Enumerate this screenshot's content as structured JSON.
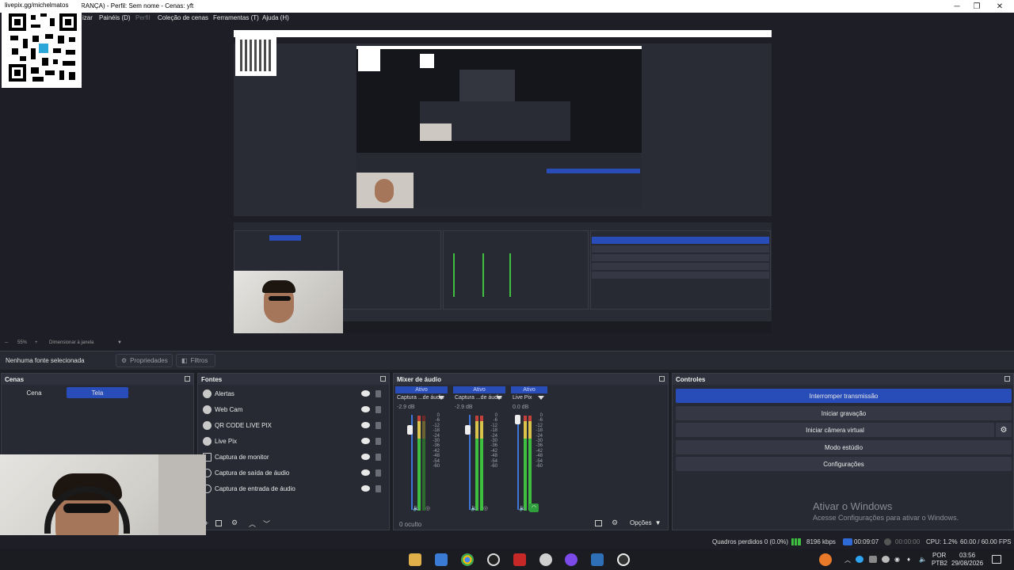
{
  "window": {
    "title": "GURANÇA) - Perfil: Sem nome - Cenas: yft",
    "minimize": "─",
    "maximize": "❐",
    "close": "✕"
  },
  "menu": {
    "items": [
      "izar",
      "Painéis (D)",
      "Perfil",
      "Coleção de cenas",
      "Ferramentas (T)",
      "Ajuda (H)"
    ]
  },
  "overlay": {
    "qr_label": "livepix.gg/michelmatos"
  },
  "zoom": {
    "value": "55%",
    "mode": "Dimensionar à janela"
  },
  "context": {
    "no_source": "Nenhuma fonte selecionada",
    "properties": "Propriedades",
    "filters": "Filtros"
  },
  "scenes": {
    "title": "Cenas",
    "items": [
      "Cena",
      "Tela"
    ]
  },
  "sources": {
    "title": "Fontes",
    "items": [
      "Alertas",
      "Web Cam",
      "QR CODE LIVE PIX",
      "Live Pix",
      "Captura de monitor",
      "Captura de saída de áudio",
      "Captura de entrada de áudio"
    ]
  },
  "mixer": {
    "title": "Mixer de áudio",
    "channels": [
      {
        "status": "Ativo",
        "name": "Captura ...de áudio",
        "db": "-2.9 dB"
      },
      {
        "status": "Ativo",
        "name": "Captura ...de áudio",
        "db": "-2.9 dB"
      },
      {
        "status": "Ativo",
        "name": "Live Pix",
        "db": "0.0 dB"
      }
    ],
    "scale": [
      "0",
      "-6",
      "-12",
      "-18",
      "-24",
      "-30",
      "-36",
      "-42",
      "-48",
      "-54",
      "-60"
    ],
    "hidden": "0 oculto",
    "options": "Opções"
  },
  "controls": {
    "title": "Controles",
    "buttons": [
      "Interromper transmissão",
      "Iniciar gravação",
      "Iniciar câmera virtual",
      "Modo estúdio",
      "Configurações"
    ]
  },
  "watermark": {
    "line1": "Ativar o Windows",
    "line2": "Acesse Configurações para ativar o Windows."
  },
  "status": {
    "dropped": "Quadros perdidos 0 (0.0%)",
    "bitrate": "8196 kbps",
    "live_time": "00:09:07",
    "rec_time": "00:00:00",
    "cpu": "CPU: 1.2%",
    "fps": "60.00 / 60.00 FPS"
  },
  "taskbar": {
    "lang": "POR",
    "layout": "PTB2",
    "time": "03:56",
    "date": "29/08/2026"
  },
  "colors": {
    "accent": "#284cb8",
    "panel": "#272a33",
    "background": "#1e1f26"
  }
}
